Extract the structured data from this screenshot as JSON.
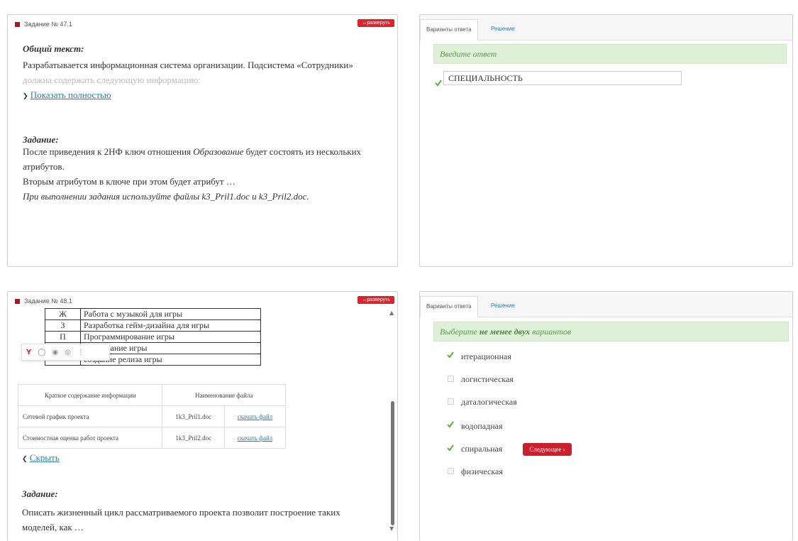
{
  "task1": {
    "header": "Задание № 47.1",
    "expand_label": "разверуть",
    "general_title": "Общий текст:",
    "general_line1": "Разрабатывается информационная система организации. Подсистема «Сотрудники»",
    "general_line2": "должна содержать следующую информацию:",
    "show_full": "Показать полностью",
    "task_title": "Задание:",
    "task_line1_a": "После приведения к 2НФ ключ отношения ",
    "task_line1_b": "Образование",
    "task_line1_c": " будет состоять из нескольких",
    "task_line2": "атрибутов.",
    "task_line3": "Вторым атрибутом в ключе при этом будет атрибут …",
    "task_line4": "При выполнении задания используйте файлы k3_Pril1.doc и k3_Pril2.doc."
  },
  "answer1": {
    "tab_variants": "Варианты ответа",
    "tab_solution": "Решение",
    "banner": "Введите ответ",
    "answer_value": "СПЕЦИАЛЬНОСТЬ"
  },
  "task2": {
    "header": "Задание № 48.1",
    "expand_label": "разверуть",
    "table_rows": [
      {
        "code": "Ж",
        "text": "Работа с музыкой для игры"
      },
      {
        "code": "З",
        "text": "Разработка гейм-дизайна для игры"
      },
      {
        "code": "П",
        "text": "Программирование игры"
      },
      {
        "code": "",
        "text": "ование игры"
      },
      {
        "code": "",
        "text": "создание релиза игры"
      }
    ],
    "files_header": [
      "Краткое содержание информации",
      "Наименование файла"
    ],
    "files_rows": [
      {
        "desc": "Сетевой график проекта",
        "file": "1k3_Pril1.doc",
        "link": "скачать файл"
      },
      {
        "desc": "Стоимостная оценка работ проекта",
        "file": "1k3_Pril2.doc",
        "link": "скачать файл"
      }
    ],
    "hide_label": "Скрыть",
    "task_title": "Задание:",
    "task_line1": "Описать жизненный цикл рассматриваемого проекта позволит построение таких",
    "task_line2": "моделей, как …"
  },
  "answer2": {
    "tab_variants": "Варианты ответа",
    "tab_solution": "Решение",
    "banner_a": "Выберите ",
    "banner_b": "не менее двух",
    "banner_c": " вариантов",
    "options": [
      {
        "label": "итерационная",
        "checked": true
      },
      {
        "label": "логистическая",
        "checked": false
      },
      {
        "label": "даталогическая",
        "checked": false
      },
      {
        "label": "водопадная",
        "checked": true
      },
      {
        "label": "спиральная",
        "checked": true
      },
      {
        "label": "физическая",
        "checked": false
      }
    ],
    "next_label": "Следующее ›"
  },
  "colors": {
    "accent_red": "#d9232d",
    "check_green": "#6ab04c",
    "banner_green": "#dff0d8",
    "link_blue": "#2a7ab8"
  }
}
